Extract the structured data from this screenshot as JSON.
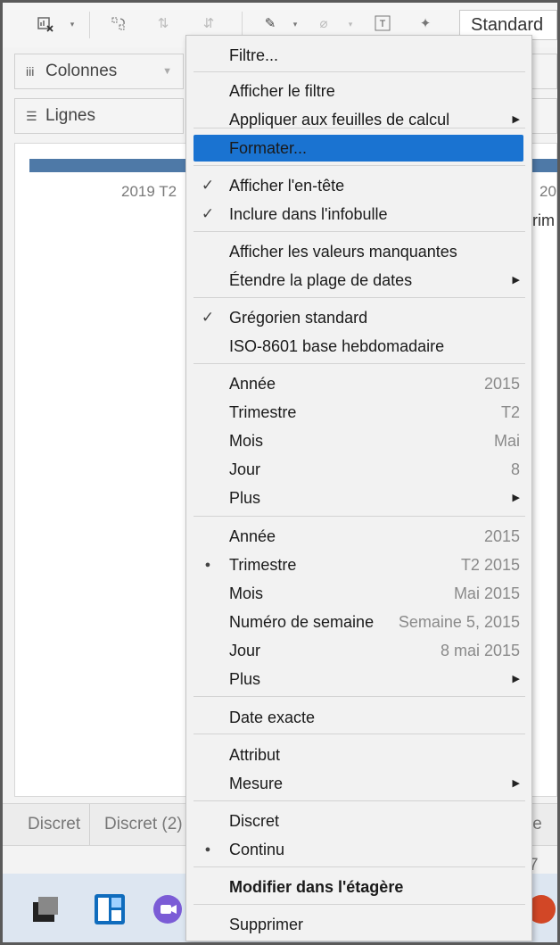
{
  "toolbar": {
    "standard_label": "Standard",
    "icons": [
      "clear-sheet-icon",
      "dropdown-caret-icon",
      "swap-icon",
      "sort-asc-icon",
      "sort-desc-icon",
      "highlight-icon",
      "attach-icon",
      "text-label-icon",
      "pin-icon"
    ]
  },
  "shelves": {
    "columns_label": "Colonnes",
    "rows_label": "Lignes"
  },
  "canvas": {
    "axis_left": "2019 T2",
    "axis_right": "20",
    "axis_right_second": "rim"
  },
  "status_tabs": [
    "Discret",
    "Discret (2)",
    "le 7"
  ],
  "menu": {
    "items": [
      {
        "label": "Filtre..."
      },
      {
        "label": "Afficher le filtre"
      },
      {
        "label": "Appliquer aux feuilles de calcul",
        "submenu": true
      },
      {
        "label": "Formater...",
        "highlighted": true
      },
      {
        "label": "Afficher l'en-tête",
        "checked": true
      },
      {
        "label": "Inclure dans l'infobulle",
        "checked": true
      },
      {
        "label": "Afficher les valeurs manquantes"
      },
      {
        "label": "Étendre la plage de dates",
        "submenu": true
      },
      {
        "label": "Grégorien standard",
        "checked": true
      },
      {
        "label": "ISO-8601 base hebdomadaire"
      },
      {
        "label": "Année",
        "value": "2015"
      },
      {
        "label": "Trimestre",
        "value": "T2"
      },
      {
        "label": "Mois",
        "value": "Mai"
      },
      {
        "label": "Jour",
        "value": "8"
      },
      {
        "label": "Plus",
        "submenu": true
      },
      {
        "label": "Année",
        "value": "2015"
      },
      {
        "label": "Trimestre",
        "value": "T2 2015",
        "dot": true
      },
      {
        "label": "Mois",
        "value": "Mai 2015"
      },
      {
        "label": "Numéro de semaine",
        "value": "Semaine 5, 2015"
      },
      {
        "label": "Jour",
        "value": "8 mai 2015"
      },
      {
        "label": "Plus",
        "submenu": true
      },
      {
        "label": "Date exacte"
      },
      {
        "label": "Attribut"
      },
      {
        "label": "Mesure",
        "submenu": true
      },
      {
        "label": "Discret"
      },
      {
        "label": "Continu",
        "dot": true
      },
      {
        "label": "Modifier dans l'étagère",
        "bold": true
      },
      {
        "label": "Supprimer"
      }
    ]
  },
  "colors": {
    "highlight": "#1a73d1",
    "bar": "#4e79a7"
  }
}
